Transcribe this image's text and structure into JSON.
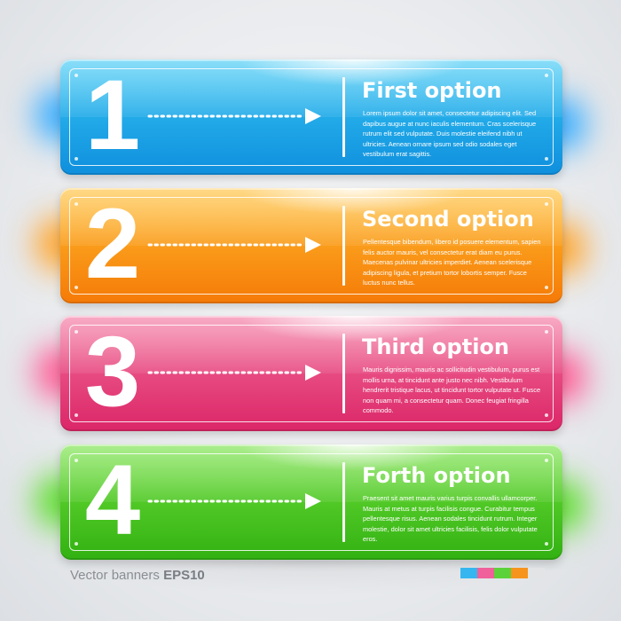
{
  "colors": {
    "blue": "#1ba9ea",
    "orange": "#fa9a1a",
    "pink": "#e94882",
    "green": "#4cc826",
    "white": "#ffffff"
  },
  "banners": [
    {
      "number": "1",
      "title": "First option",
      "text": "Lorem ipsum dolor sit amet, consectetur adipiscing elit. Sed dapibus augue at nunc iaculis elementum. Cras scelerisque rutrum elit sed vulputate. Duis molestie eleifend nibh ut ultricies. Aenean ornare ipsum sed odio sodales eget vestibulum erat sagittis."
    },
    {
      "number": "2",
      "title": "Second option",
      "text": "Pellentesque bibendum, libero id posuere elementum, sapien felis auctor mauris, vel consectetur erat diam eu purus. Maecenas pulvinar ultricies imperdiet. Aenean scelerisque adipiscing ligula, et pretium tortor lobortis semper. Fusce luctus nunc tellus."
    },
    {
      "number": "3",
      "title": "Third option",
      "text": "Mauris dignissim, mauris ac sollicitudin vestibulum, purus est mollis urna, at tincidunt ante justo nec nibh. Vestibulum hendrerit tristique lacus, ut tincidunt tortor vulputate ut. Fusce non quam mi, a consectetur quam. Donec feugiat fringilla commodo."
    },
    {
      "number": "4",
      "title": "Forth option",
      "text": "Praesent sit amet mauris varius turpis convallis ullamcorper. Mauris at metus at turpis facilisis congue. Curabitur tempus pellentesque risus. Aenean sodales tincidunt rutrum. Integer molestie, dolor sit amet ultricies facilisis, felis dolor vulputate eros."
    }
  ],
  "footer": {
    "label": "Vector banners",
    "format": "EPS10"
  },
  "swatches": [
    "#35b6f0",
    "#f0609a",
    "#5cd23a",
    "#f7941d",
    "#e2e4e6"
  ],
  "icons": {
    "arrow": "dotted-arrow-icon"
  }
}
